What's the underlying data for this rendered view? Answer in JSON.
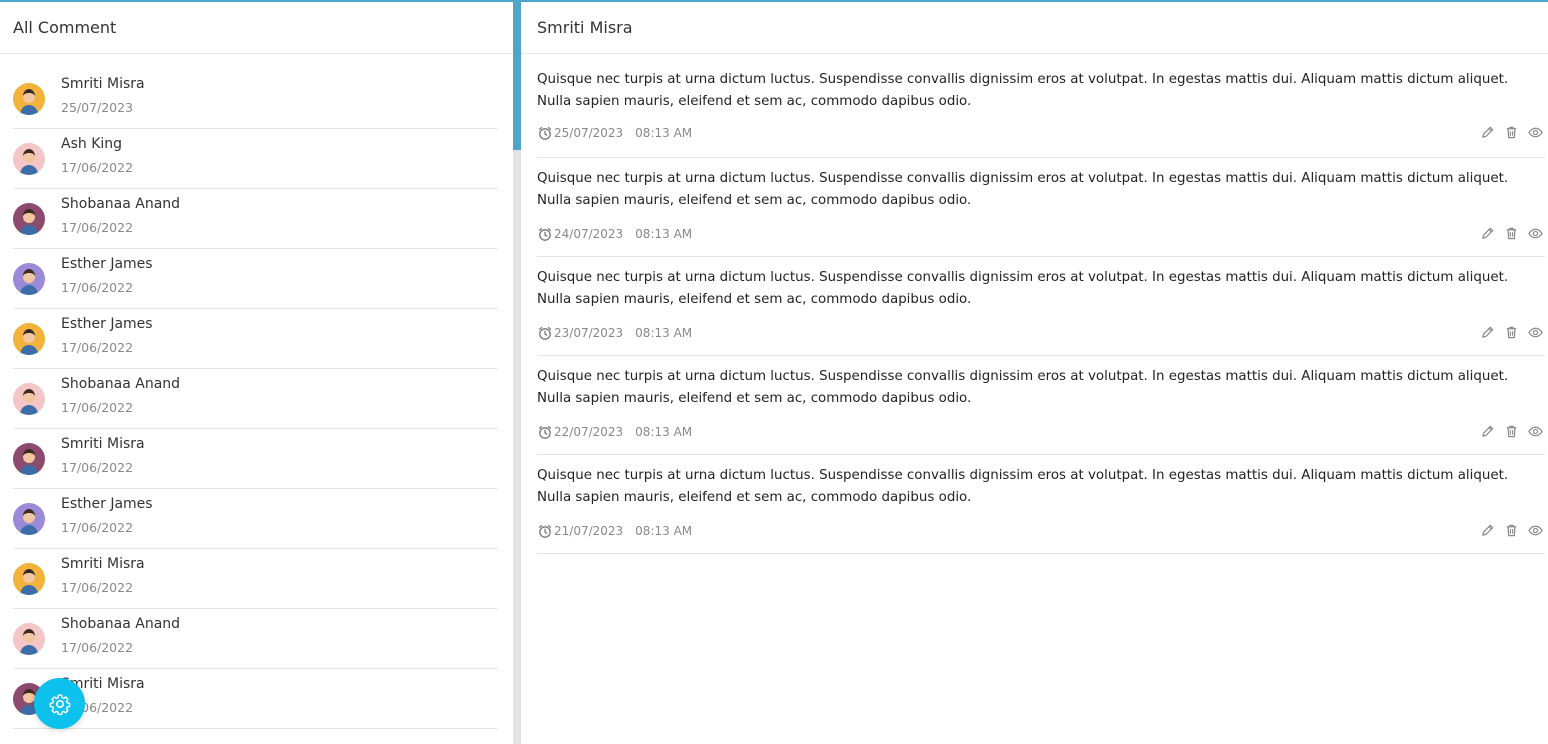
{
  "left": {
    "title": "All Comment",
    "contacts": [
      {
        "name": "Smriti Misra",
        "date": "25/07/2023",
        "avatar_bg": "#f3b23a"
      },
      {
        "name": "Ash King",
        "date": "17/06/2022",
        "avatar_bg": "#f5c6c6"
      },
      {
        "name": "Shobanaa Anand",
        "date": "17/06/2022",
        "avatar_bg": "#8b4a6e"
      },
      {
        "name": "Esther James",
        "date": "17/06/2022",
        "avatar_bg": "#9a8ad8"
      },
      {
        "name": "Esther James",
        "date": "17/06/2022",
        "avatar_bg": "#f3b23a"
      },
      {
        "name": "Shobanaa Anand",
        "date": "17/06/2022",
        "avatar_bg": "#f5c6c6"
      },
      {
        "name": "Smriti Misra",
        "date": "17/06/2022",
        "avatar_bg": "#8b4a6e"
      },
      {
        "name": "Esther James",
        "date": "17/06/2022",
        "avatar_bg": "#9a8ad8"
      },
      {
        "name": "Smriti Misra",
        "date": "17/06/2022",
        "avatar_bg": "#f3b23a"
      },
      {
        "name": "Shobanaa Anand",
        "date": "17/06/2022",
        "avatar_bg": "#f5c6c6"
      },
      {
        "name": "Smriti Misra",
        "date": "17/06/2022",
        "avatar_bg": "#8b4a6e"
      }
    ]
  },
  "right": {
    "title": "Smriti Misra",
    "comments": [
      {
        "text": "Quisque nec turpis at urna dictum luctus. Suspendisse convallis dignissim eros at volutpat. In egestas mattis dui. Aliquam mattis dictum aliquet. Nulla sapien mauris, eleifend et sem ac, commodo dapibus odio.",
        "date": "25/07/2023",
        "time": "08:13 AM"
      },
      {
        "text": "Quisque nec turpis at urna dictum luctus. Suspendisse convallis dignissim eros at volutpat. In egestas mattis dui. Aliquam mattis dictum aliquet. Nulla sapien mauris, eleifend et sem ac, commodo dapibus odio.",
        "date": "24/07/2023",
        "time": "08:13 AM"
      },
      {
        "text": "Quisque nec turpis at urna dictum luctus. Suspendisse convallis dignissim eros at volutpat. In egestas mattis dui. Aliquam mattis dictum aliquet. Nulla sapien mauris, eleifend et sem ac, commodo dapibus odio.",
        "date": "23/07/2023",
        "time": "08:13 AM"
      },
      {
        "text": "Quisque nec turpis at urna dictum luctus. Suspendisse convallis dignissim eros at volutpat. In egestas mattis dui. Aliquam mattis dictum aliquet. Nulla sapien mauris, eleifend et sem ac, commodo dapibus odio.",
        "date": "22/07/2023",
        "time": "08:13 AM"
      },
      {
        "text": "Quisque nec turpis at urna dictum luctus. Suspendisse convallis dignissim eros at volutpat. In egestas mattis dui. Aliquam mattis dictum aliquet. Nulla sapien mauris, eleifend et sem ac, commodo dapibus odio.",
        "date": "21/07/2023",
        "time": "08:13 AM"
      }
    ]
  },
  "icons": {
    "clock": "clock-icon",
    "edit": "pencil-icon",
    "delete": "trash-icon",
    "view": "eye-icon",
    "settings": "gear-icon"
  },
  "colors": {
    "accent": "#4ba6c9",
    "fab": "#0cc1ec"
  }
}
